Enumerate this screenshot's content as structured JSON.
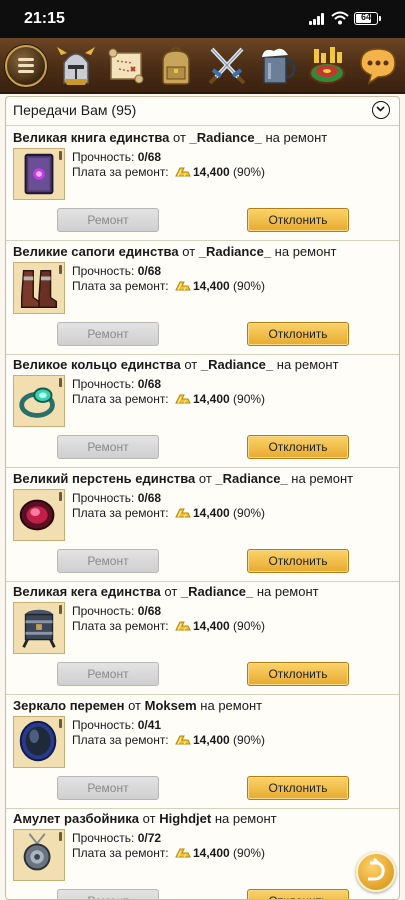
{
  "status_bar": {
    "time": "21:15",
    "battery": "64"
  },
  "nav": {
    "icons": [
      "menu-icon",
      "helmet-icon",
      "scroll-map-icon",
      "backpack-icon",
      "crossed-swords-icon",
      "tavern-mug-icon",
      "roulette-icon",
      "chat-icon"
    ]
  },
  "panel": {
    "title": "Передачи Вам (95)"
  },
  "entries": [
    {
      "item": "Великая книга единства",
      "from_word": "от",
      "sender": "_Radiance_",
      "suffix": "на ремонт",
      "durability_label": "Прочность:",
      "durability": "0/68",
      "fee_label": "Плата за ремонт:",
      "fee": "14,400",
      "fee_pct": "(90%)",
      "repair_label": "Ремонт",
      "reject_label": "Отклонить",
      "icon": "book-icon"
    },
    {
      "item": "Великие сапоги единства",
      "from_word": "от",
      "sender": "_Radiance_",
      "suffix": "на ремонт",
      "durability_label": "Прочность:",
      "durability": "0/68",
      "fee_label": "Плата за ремонт:",
      "fee": "14,400",
      "fee_pct": "(90%)",
      "repair_label": "Ремонт",
      "reject_label": "Отклонить",
      "icon": "boots-icon"
    },
    {
      "item": "Великое кольцо единства",
      "from_word": "от",
      "sender": "_Radiance_",
      "suffix": "на ремонт",
      "durability_label": "Прочность:",
      "durability": "0/68",
      "fee_label": "Плата за ремонт:",
      "fee": "14,400",
      "fee_pct": "(90%)",
      "repair_label": "Ремонт",
      "reject_label": "Отклонить",
      "icon": "ring-icon"
    },
    {
      "item": "Великий перстень единства",
      "from_word": "от",
      "sender": "_Radiance_",
      "suffix": "на ремонт",
      "durability_label": "Прочность:",
      "durability": "0/68",
      "fee_label": "Плата за ремонт:",
      "fee": "14,400",
      "fee_pct": "(90%)",
      "repair_label": "Ремонт",
      "reject_label": "Отклонить",
      "icon": "signet-ring-icon"
    },
    {
      "item": "Великая кега единства",
      "from_word": "от",
      "sender": "_Radiance_",
      "suffix": "на ремонт",
      "durability_label": "Прочность:",
      "durability": "0/68",
      "fee_label": "Плата за ремонт:",
      "fee": "14,400",
      "fee_pct": "(90%)",
      "repair_label": "Ремонт",
      "reject_label": "Отклонить",
      "icon": "keg-icon"
    },
    {
      "item": "Зеркало перемен",
      "from_word": "от",
      "sender": "Moksem",
      "suffix": "на ремонт",
      "durability_label": "Прочность:",
      "durability": "0/41",
      "fee_label": "Плата за ремонт:",
      "fee": "14,400",
      "fee_pct": "(90%)",
      "repair_label": "Ремонт",
      "reject_label": "Отклонить",
      "icon": "mirror-icon"
    },
    {
      "item": "Амулет разбойника",
      "from_word": "от",
      "sender": "Highdjet",
      "suffix": "на ремонт",
      "durability_label": "Прочность:",
      "durability": "0/72",
      "fee_label": "Плата за ремонт:",
      "fee": "14,400",
      "fee_pct": "(90%)",
      "repair_label": "Ремонт",
      "reject_label": "Отклонить",
      "icon": "amulet-icon"
    }
  ]
}
